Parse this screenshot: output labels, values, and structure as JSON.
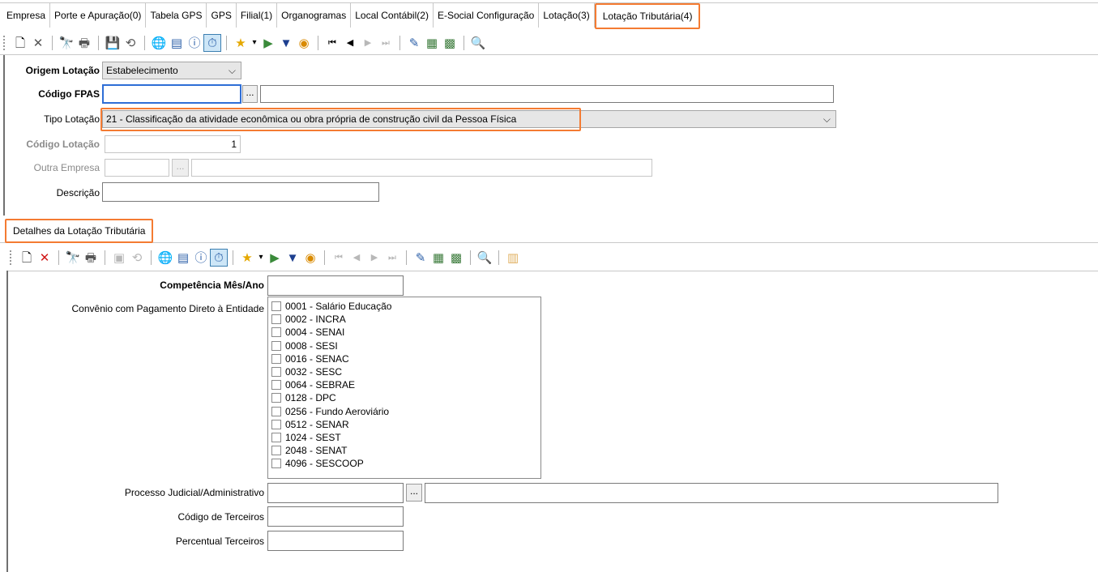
{
  "tabs": [
    {
      "label": "Empresa",
      "active": false
    },
    {
      "label": "Porte e Apuração(0)",
      "active": false
    },
    {
      "label": "Tabela GPS",
      "active": false
    },
    {
      "label": "GPS",
      "active": false
    },
    {
      "label": "Filial(1)",
      "active": false
    },
    {
      "label": "Organogramas",
      "active": false
    },
    {
      "label": "Local Contábil(2)",
      "active": false
    },
    {
      "label": "E-Social Configuração",
      "active": false
    },
    {
      "label": "Lotação(3)",
      "active": false
    },
    {
      "label": "Lotação Tributária(4)",
      "active": true
    }
  ],
  "main_toolbar": {
    "icons": [
      "new-icon",
      "delete-icon",
      "search-icon",
      "print-icon",
      "save-icon",
      "refresh-icon",
      "globe-icon",
      "list-icon",
      "info-icon",
      "clock-icon",
      "star-icon",
      "dropdown-arrow-icon",
      "export-icon",
      "filter-icon",
      "sync-icon",
      "first-record-icon",
      "previous-record-icon",
      "next-record-icon",
      "last-record-icon",
      "edit-icon",
      "report-icon",
      "report-search-icon",
      "preview-icon"
    ]
  },
  "form": {
    "origem_lotacao_label": "Origem Lotação",
    "origem_lotacao_value": "Estabelecimento",
    "codigo_fpas_label": "Código FPAS",
    "codigo_fpas_value": "",
    "codigo_fpas_desc": "",
    "tipo_lotacao_label": "Tipo Lotação",
    "tipo_lotacao_value": "21 - Classificação da atividade econômica ou obra própria de construção civil da Pessoa Física",
    "codigo_lotacao_label": "Código Lotação",
    "codigo_lotacao_value": "1",
    "outra_empresa_label": "Outra Empresa",
    "outra_empresa_value": "",
    "outra_empresa_desc": "",
    "descricao_label": "Descrição",
    "descricao_value": "",
    "dots": "..."
  },
  "subtab": {
    "label": "Detalhes da Lotação Tributária"
  },
  "details": {
    "competencia_label": "Competência Mês/Ano",
    "competencia_value": "",
    "convenio_label": "Convênio com Pagamento Direto à Entidade",
    "convenio_items": [
      "0001 - Salário Educação",
      "0002 - INCRA",
      "0004 - SENAI",
      "0008 - SESI",
      "0016 - SENAC",
      "0032 - SESC",
      "0064 - SEBRAE",
      "0128 - DPC",
      "0256 - Fundo Aeroviário",
      "0512 - SENAR",
      "1024 - SEST",
      "2048 - SENAT",
      "4096 - SESCOOP"
    ],
    "processo_label": "Processo Judicial/Administrativo",
    "processo_value": "",
    "processo_desc": "",
    "codigo_terceiros_label": "Código de Terceiros",
    "codigo_terceiros_value": "",
    "percentual_terceiros_label": "Percentual Terceiros",
    "percentual_terceiros_value": "",
    "dots": "..."
  },
  "colors": {
    "accent_orange": "#f47b32",
    "focus_blue": "#2e6ed6"
  }
}
